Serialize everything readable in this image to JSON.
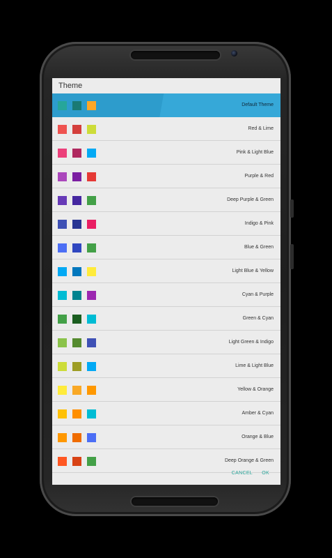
{
  "dialog": {
    "title": "Theme",
    "cancel_label": "CANCEL",
    "ok_label": "OK"
  },
  "themes": [
    {
      "name": "Default Theme",
      "selected": true,
      "colors": [
        "#26a69a",
        "#1a7a74",
        "#ffa726"
      ]
    },
    {
      "name": "Red & Lime",
      "selected": false,
      "colors": [
        "#ef5350",
        "#d43f3c",
        "#cddc39"
      ]
    },
    {
      "name": "Pink & Light Blue",
      "selected": false,
      "colors": [
        "#ec407a",
        "#b0295f",
        "#03a9f4"
      ]
    },
    {
      "name": "Purple & Red",
      "selected": false,
      "colors": [
        "#ab47bc",
        "#7b1fa2",
        "#e53935"
      ]
    },
    {
      "name": "Deep Purple & Green",
      "selected": false,
      "colors": [
        "#673ab7",
        "#4527a0",
        "#43a047"
      ]
    },
    {
      "name": "Indigo & Pink",
      "selected": false,
      "colors": [
        "#3f51b5",
        "#283593",
        "#e91e63"
      ]
    },
    {
      "name": "Blue & Green",
      "selected": false,
      "colors": [
        "#4c6ef5",
        "#3047c0",
        "#43a047"
      ]
    },
    {
      "name": "Light Blue & Yellow",
      "selected": false,
      "colors": [
        "#03a9f4",
        "#0277bd",
        "#ffeb3b"
      ]
    },
    {
      "name": "Cyan & Purple",
      "selected": false,
      "colors": [
        "#00bcd4",
        "#00838f",
        "#9c27b0"
      ]
    },
    {
      "name": "Green & Cyan",
      "selected": false,
      "colors": [
        "#43a047",
        "#1b5e20",
        "#00bcd4"
      ]
    },
    {
      "name": "Light Green & Indigo",
      "selected": false,
      "colors": [
        "#8bc34a",
        "#558b2f",
        "#3f51b5"
      ]
    },
    {
      "name": "Lime & Light Blue",
      "selected": false,
      "colors": [
        "#cddc39",
        "#9e9d24",
        "#03a9f4"
      ]
    },
    {
      "name": "Yellow & Orange",
      "selected": false,
      "colors": [
        "#ffeb3b",
        "#f9a825",
        "#ff9800"
      ]
    },
    {
      "name": "Amber & Cyan",
      "selected": false,
      "colors": [
        "#ffc107",
        "#ff8f00",
        "#00bcd4"
      ]
    },
    {
      "name": "Orange & Blue",
      "selected": false,
      "colors": [
        "#ff9800",
        "#ef6c00",
        "#4c6ef5"
      ]
    },
    {
      "name": "Deep Orange & Green",
      "selected": false,
      "colors": [
        "#ff5722",
        "#d84315",
        "#43a047"
      ]
    }
  ]
}
